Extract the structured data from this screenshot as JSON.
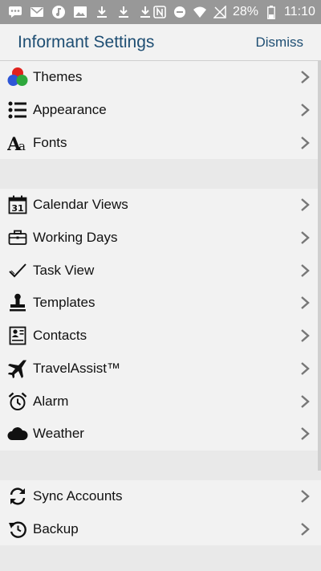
{
  "status_bar": {
    "battery": "28%",
    "time": "11:10"
  },
  "header": {
    "title": "Informant Settings",
    "dismiss_label": "Dismiss"
  },
  "groups": [
    {
      "items": [
        {
          "label": "Themes",
          "icon": "themes-icon"
        },
        {
          "label": "Appearance",
          "icon": "list-icon"
        },
        {
          "label": "Fonts",
          "icon": "fonts-icon"
        }
      ]
    },
    {
      "items": [
        {
          "label": "Calendar Views",
          "icon": "calendar-icon"
        },
        {
          "label": "Working Days",
          "icon": "briefcase-icon"
        },
        {
          "label": "Task View",
          "icon": "checkmark-icon"
        },
        {
          "label": "Templates",
          "icon": "stamp-icon"
        },
        {
          "label": "Contacts",
          "icon": "contact-card-icon"
        },
        {
          "label": "TravelAssist™",
          "icon": "airplane-icon"
        },
        {
          "label": "Alarm",
          "icon": "alarm-clock-icon"
        },
        {
          "label": "Weather",
          "icon": "cloud-icon"
        }
      ]
    },
    {
      "items": [
        {
          "label": "Sync Accounts",
          "icon": "sync-icon"
        },
        {
          "label": "Backup",
          "icon": "backup-icon"
        }
      ]
    }
  ]
}
